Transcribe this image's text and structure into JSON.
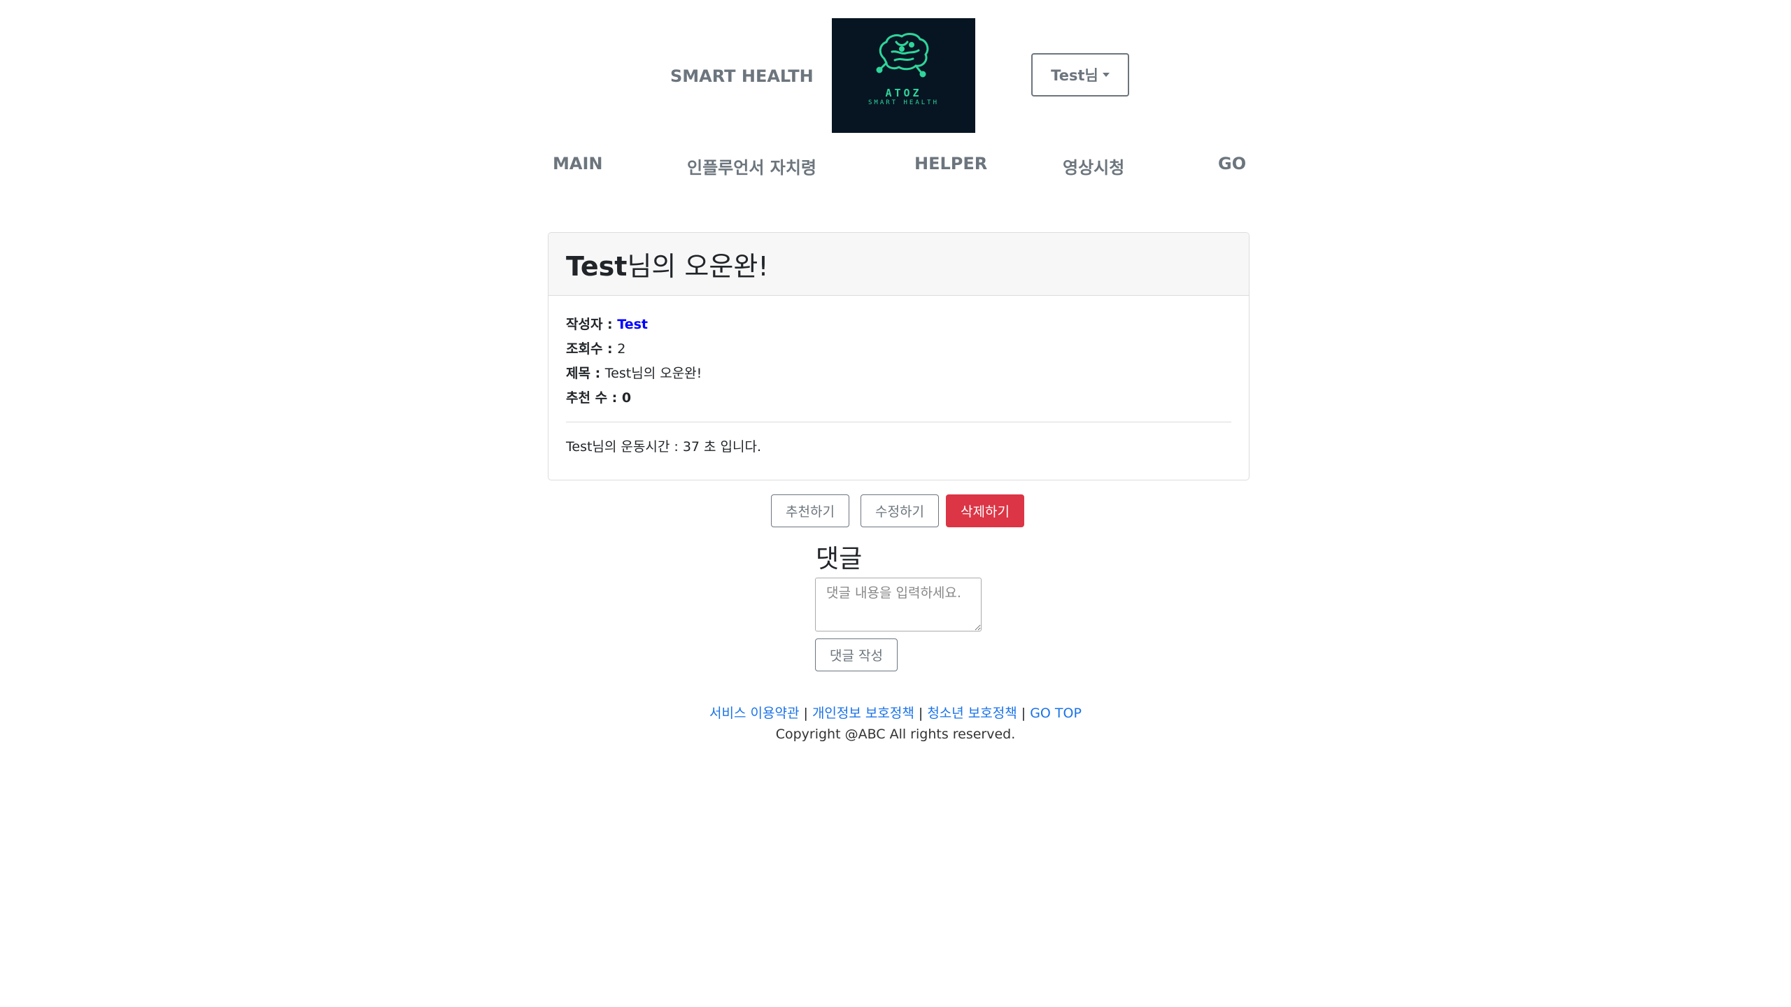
{
  "header": {
    "site_title": "SMART HEALTH",
    "logo": {
      "line1": "ATOZ",
      "line2": "SMART HEALTH",
      "icon": "brain-circuit-icon",
      "bg_color": "#071523",
      "accent_color": "#2fd59a"
    },
    "user_menu_label": "Test님"
  },
  "nav": {
    "items": [
      {
        "label": "MAIN"
      },
      {
        "label": "인플루언서 자치령"
      },
      {
        "label": "HELPER"
      },
      {
        "label": "영상시청"
      },
      {
        "label": "GO"
      }
    ]
  },
  "post": {
    "title_bold": "Test",
    "title_rest": "님의 오운완!",
    "author_label": "작성자 : ",
    "author_value": "Test",
    "views_label": "조회수 : ",
    "views_value": "2",
    "subject_label": "제목 : ",
    "subject_value": "Test님의 오운완!",
    "likes_label": "추천 수 : ",
    "likes_value": "0",
    "content": "Test님의 운동시간 : 37 초 입니다."
  },
  "actions": {
    "recommend_label": "추천하기",
    "edit_label": "수정하기",
    "delete_label": "삭제하기",
    "danger_color": "#dc3545"
  },
  "comments": {
    "heading": "댓글",
    "placeholder": "댓글 내용을 입력하세요.",
    "submit_label": "댓글 작성"
  },
  "footer": {
    "links": [
      {
        "label": "서비스 이용약관"
      },
      {
        "label": "개인정보 보호정책"
      },
      {
        "label": "청소년 보호정책"
      },
      {
        "label": "GO TOP"
      }
    ],
    "separator": " | ",
    "copyright": "Copyright @ABC All rights reserved."
  }
}
